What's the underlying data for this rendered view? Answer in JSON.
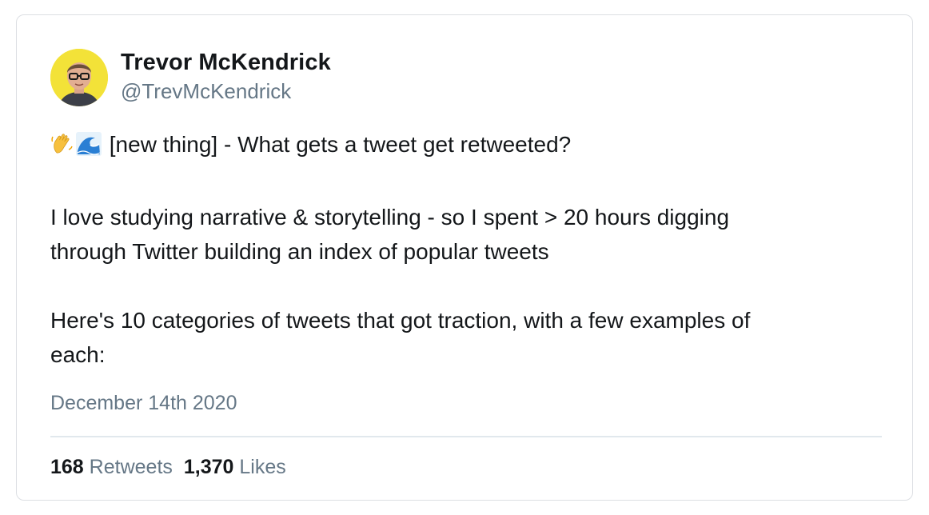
{
  "tweet": {
    "author": {
      "name": "Trevor McKendrick",
      "handle": "@TrevMcKendrick"
    },
    "emojis": [
      "waving-hand",
      "water-wave"
    ],
    "lines": {
      "first": "[new thing] - What gets a tweet get retweeted?",
      "second_a": "I love studying narrative & storytelling - so I spent > 20 hours digging",
      "second_b": "through Twitter building an index of popular tweets",
      "third_a": "Here's 10 categories of tweets that got traction, with a few examples of",
      "third_b": "each:"
    },
    "date": "December 14th 2020",
    "stats": {
      "retweets_count": "168",
      "retweets_label": "Retweets",
      "likes_count": "1,370",
      "likes_label": "Likes"
    }
  },
  "colors": {
    "text": "#14171a",
    "muted": "#657786",
    "border": "#dcdfe3",
    "avatar_bg": "#f3e238"
  }
}
